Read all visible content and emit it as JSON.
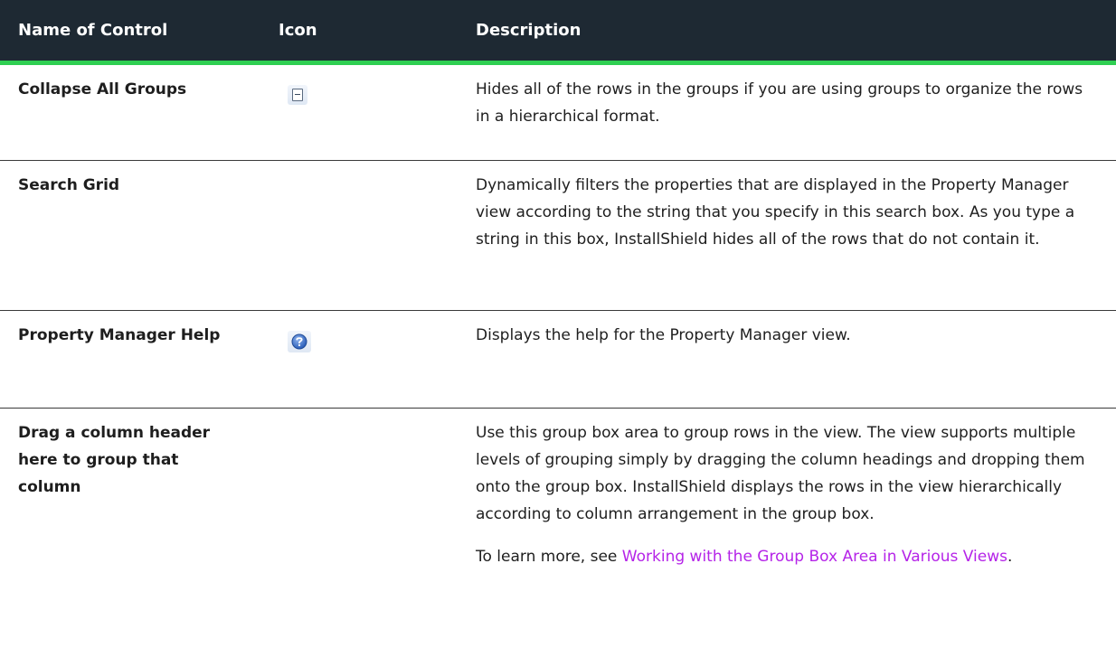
{
  "table": {
    "headers": {
      "name": "Name of Control",
      "icon": "Icon",
      "description": "Description"
    },
    "rows": [
      {
        "name": "Collapse All Groups",
        "icon": "collapse-all-icon",
        "description": "Hides all of the rows in the groups if you are using groups to organize the rows in a hierarchical format."
      },
      {
        "name": "Search Grid",
        "icon": "",
        "description": "Dynamically filters the properties that are displayed in the Property Manager view according to the string that you specify in this search box. As you type a string in this box, InstallShield hides all of the rows that do not contain it."
      },
      {
        "name": "Property Manager Help",
        "icon": "help-icon",
        "description": "Displays the help for the Property Manager view."
      },
      {
        "name": "Drag a column header here to group that column",
        "icon": "",
        "description": "Use this group box area to group rows in the view. The view supports multiple levels of grouping simply by dragging the column headings and dropping them onto the group box. InstallShield displays the rows in the view hierarchically according to column arrangement in the group box.",
        "note_prefix": "To learn more, see ",
        "note_link": "Working with the Group Box Area in Various Views",
        "note_suffix": "."
      }
    ]
  },
  "colors": {
    "header_bg": "#1e2933",
    "header_rule": "#2fcf52",
    "link": "#b524e8"
  }
}
